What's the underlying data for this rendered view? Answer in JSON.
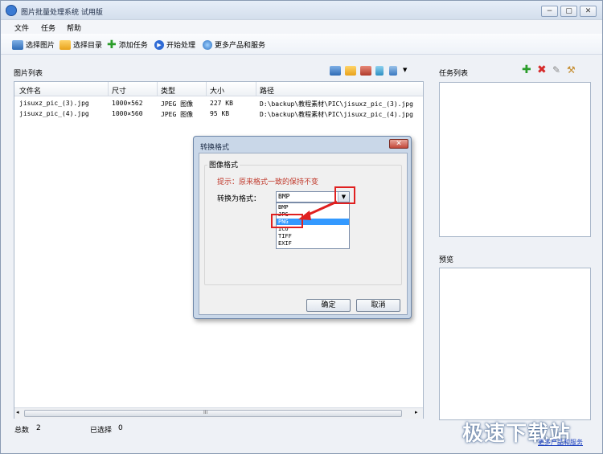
{
  "window": {
    "title": "图片批量处理系统 试用版",
    "minimize": "−",
    "restore": "▢",
    "close": "✕"
  },
  "menu": [
    "文件",
    "任务",
    "帮助"
  ],
  "toolbar": {
    "select_images": "选择图片",
    "select_dir": "选择目录",
    "add_task": "添加任务",
    "start": "开始处理",
    "more": "更多产品和服务"
  },
  "image_list": {
    "title": "图片列表",
    "columns": [
      "文件名",
      "尺寸",
      "类型",
      "大小",
      "路径"
    ],
    "rows": [
      {
        "name": "jisuxz_pic_(3).jpg",
        "size": "1000×562",
        "type": "JPEG 图像",
        "filesize": "227 KB",
        "path": "D:\\backup\\教程素材\\PIC\\jisuxz_pic_(3).jpg"
      },
      {
        "name": "jisuxz_pic_(4).jpg",
        "size": "1000×560",
        "type": "JPEG 图像",
        "filesize": "95 KB",
        "path": "D:\\backup\\教程素材\\PIC\\jisuxz_pic_(4).jpg"
      }
    ],
    "scroll_grip": "III"
  },
  "status": {
    "total_label": "总数",
    "total": "2",
    "selected_label": "已选择",
    "selected": "0"
  },
  "task_list": {
    "title": "任务列表"
  },
  "preview": {
    "title": "预览"
  },
  "dialog": {
    "title": "转换格式",
    "close": "✕",
    "group": "图像格式",
    "hint": "提示：原来格式一致的保持不变",
    "label": "转换为格式：",
    "selected": "BMP",
    "options": [
      "BMP",
      "JPG",
      "PNG",
      "ICO",
      "TIFF",
      "EXIF"
    ],
    "highlighted_option": "PNG",
    "ok": "确定",
    "cancel": "取消"
  },
  "watermark": {
    "text": "极速下载站",
    "link": "更多产品和服务"
  }
}
